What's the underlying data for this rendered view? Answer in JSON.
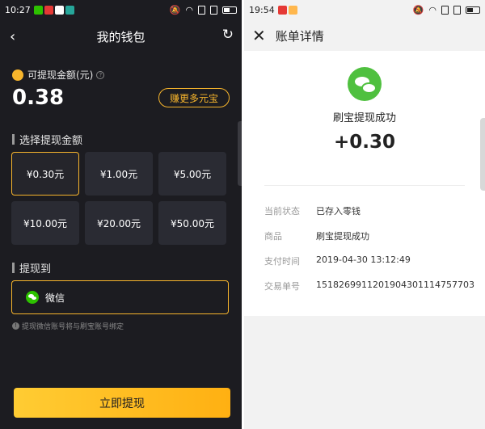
{
  "left": {
    "statusbar": {
      "time": "10:27"
    },
    "nav": {
      "title": "我的钱包",
      "back_icon": "‹",
      "refresh_icon": "↻"
    },
    "balance": {
      "label": "可提现金额(元)",
      "value": "0.38",
      "earn_button": "赚更多元宝"
    },
    "choose_section": "选择提现金额",
    "amounts": [
      "¥0.30元",
      "¥1.00元",
      "¥5.00元",
      "¥10.00元",
      "¥20.00元",
      "¥50.00元"
    ],
    "selected_index": 0,
    "withdraw_section": "提现到",
    "method": "微信",
    "hint": "提现微信账号将与刷宝账号绑定",
    "submit": "立即提现",
    "colors": {
      "accent": "#f7b52c",
      "background": "#1c1c21"
    }
  },
  "right": {
    "statusbar": {
      "time": "19:54"
    },
    "nav": {
      "title": "账单详情",
      "close_icon": "✕"
    },
    "status_title": "刷宝提现成功",
    "amount": "+0.30",
    "details": [
      {
        "label": "当前状态",
        "value": "已存入零钱"
      },
      {
        "label": "商品",
        "value": "刷宝提现成功"
      },
      {
        "label": "支付时间",
        "value": "2019-04-30 13:12:49"
      },
      {
        "label": "交易单号",
        "value": "1518269911201904301114757703"
      }
    ],
    "colors": {
      "wechat": "#4fc03f"
    }
  }
}
